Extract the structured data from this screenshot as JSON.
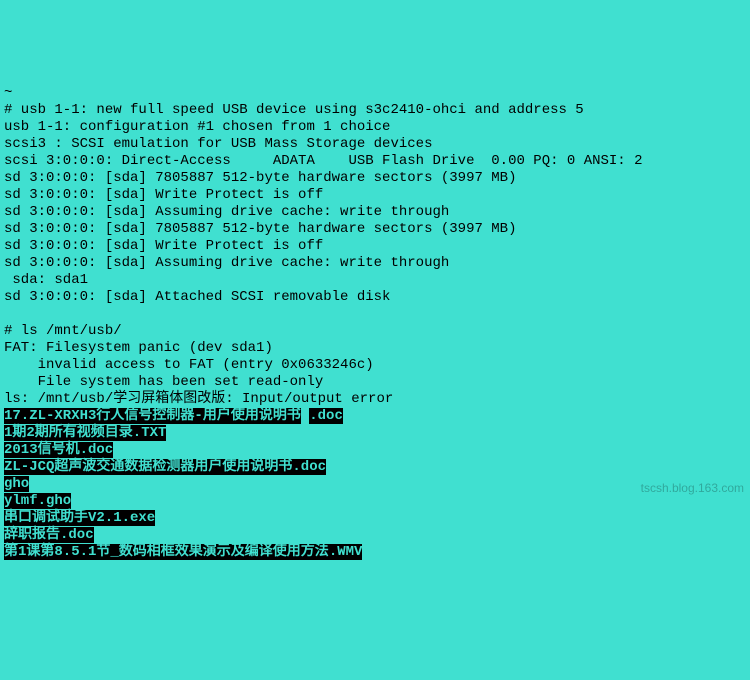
{
  "lines": {
    "l0": "~",
    "l1": "# usb 1-1: new full speed USB device using s3c2410-ohci and address 5",
    "l2": "usb 1-1: configuration #1 chosen from 1 choice",
    "l3": "scsi3 : SCSI emulation for USB Mass Storage devices",
    "l4": "scsi 3:0:0:0: Direct-Access     ADATA    USB Flash Drive  0.00 PQ: 0 ANSI: 2",
    "l5": "sd 3:0:0:0: [sda] 7805887 512-byte hardware sectors (3997 MB)",
    "l6": "sd 3:0:0:0: [sda] Write Protect is off",
    "l7": "sd 3:0:0:0: [sda] Assuming drive cache: write through",
    "l8": "sd 3:0:0:0: [sda] 7805887 512-byte hardware sectors (3997 MB)",
    "l9": "sd 3:0:0:0: [sda] Write Protect is off",
    "l10": "sd 3:0:0:0: [sda] Assuming drive cache: write through",
    "l11": " sda: sda1",
    "l12": "sd 3:0:0:0: [sda] Attached SCSI removable disk",
    "l13": "",
    "l14": "# ls /mnt/usb/",
    "l15": "FAT: Filesystem panic (dev sda1)",
    "l16": "    invalid access to FAT (entry 0x0633246c)",
    "l17": "    File system has been set read-only",
    "l18": "ls: /mnt/usb/学习屏箱体图改版: Input/output error"
  },
  "files": {
    "f1a": "17.ZL-XRXH3行人信号控制器-用户使用说明书",
    "f1b": ".doc",
    "f2": "1期2期所有视频目录.TXT",
    "f3": "2013信号机.doc",
    "f4": "ZL-JCQ超声波交通数据检测器用户使用说明书.doc",
    "f5": "gho",
    "f6": "ylmf.gho",
    "f7": "串口调试助手V2.1.exe",
    "f8": "辞职报告.doc",
    "f9a": "第1课第8.5.1节_数码相框效果演示及编译使用方法",
    "f9b": ".WMV"
  },
  "watermark": "tscsh.blog.163.com"
}
